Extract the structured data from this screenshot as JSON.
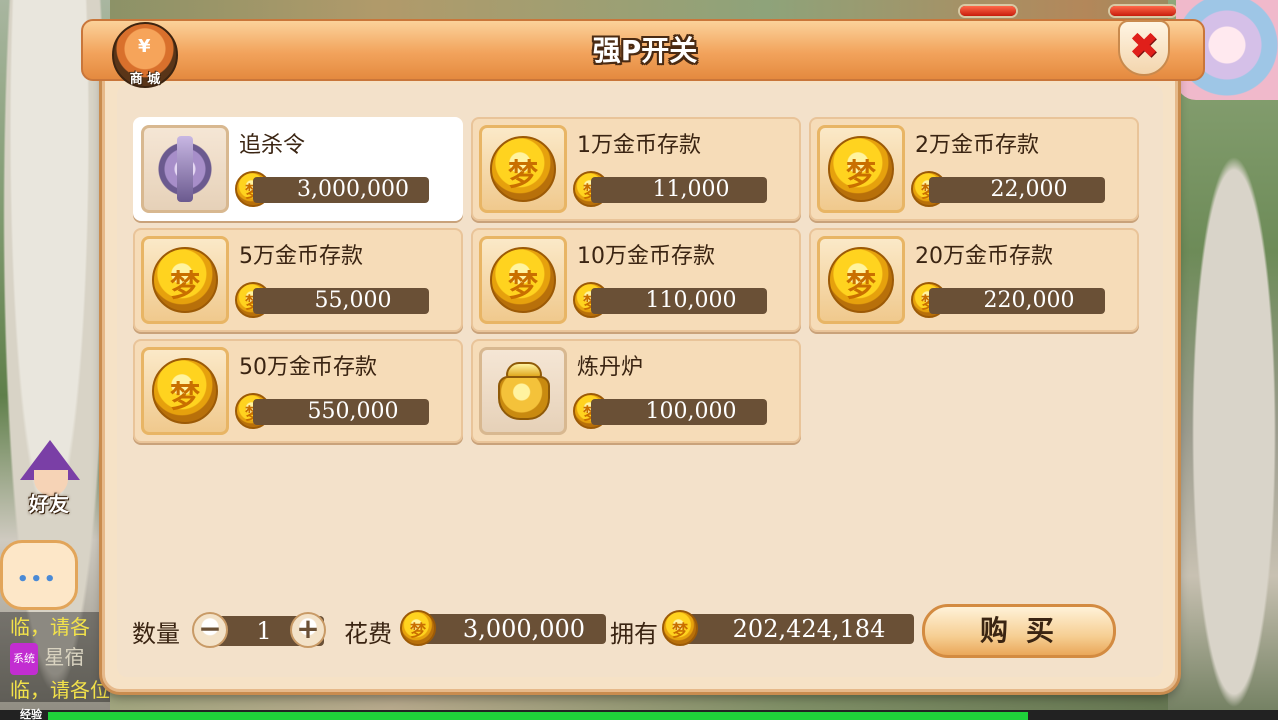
{
  "panel": {
    "title": "强P开关",
    "shop_badge_label": "商 城",
    "shop_badge_symbol": "¥",
    "close_symbol": "✖"
  },
  "items": [
    {
      "name": "追杀令",
      "price": "3,000,000",
      "icon": "chase-token-icon",
      "selected": true
    },
    {
      "name": "1万金币存款",
      "price": "11,000",
      "icon": "gold-coin-icon",
      "selected": false
    },
    {
      "name": "2万金币存款",
      "price": "22,000",
      "icon": "gold-coin-icon",
      "selected": false
    },
    {
      "name": "5万金币存款",
      "price": "55,000",
      "icon": "gold-coin-icon",
      "selected": false
    },
    {
      "name": "10万金币存款",
      "price": "110,000",
      "icon": "gold-coin-icon",
      "selected": false
    },
    {
      "name": "20万金币存款",
      "price": "220,000",
      "icon": "gold-coin-icon",
      "selected": false
    },
    {
      "name": "50万金币存款",
      "price": "550,000",
      "icon": "gold-coin-icon",
      "selected": false
    },
    {
      "name": "炼丹炉",
      "price": "100,000",
      "icon": "alchemy-furnace-icon",
      "selected": false
    }
  ],
  "coin_glyph": "梦",
  "footer": {
    "quantity_label": "数量",
    "quantity_value": "1",
    "minus": "−",
    "plus": "+",
    "cost_label": "花费",
    "cost_value": "3,000,000",
    "owned_label": "拥有",
    "owned_value": "202,424,184",
    "buy_label": "购买"
  },
  "hud": {
    "friends_label": "好友",
    "chat_dots": "•••",
    "chat_line_1": "临，请各",
    "chat_system_tag": "系统",
    "chat_line_2": "星宿",
    "chat_line_3": "临，请各位",
    "exp_label": "经验"
  },
  "colors": {
    "price_bar": "#6a5036",
    "header": "#f2a35c",
    "close_x": "#e01f1a",
    "exp_bar": "#1fd13a"
  }
}
